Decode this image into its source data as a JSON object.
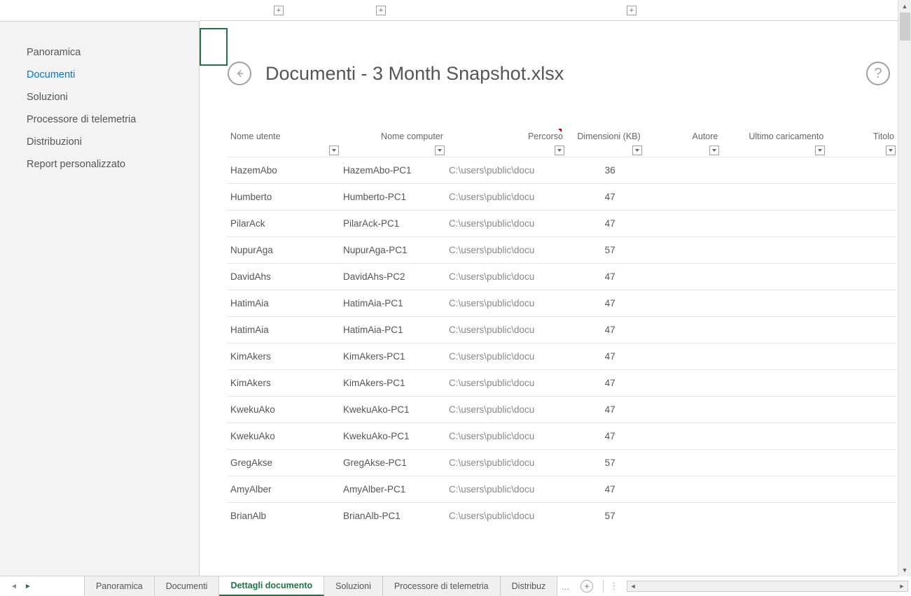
{
  "sidebar": {
    "items": [
      {
        "label": "Panoramica"
      },
      {
        "label": "Documenti"
      },
      {
        "label": "Soluzioni"
      },
      {
        "label": "Processore di telemetria"
      },
      {
        "label": "Distribuzioni"
      },
      {
        "label": "Report personalizzato"
      }
    ],
    "active_index": 1
  },
  "title": "Documenti - 3 Month Snapshot.xlsx",
  "columns": [
    {
      "label": "Nome utente",
      "align": "left"
    },
    {
      "label": "Nome computer",
      "align": "right"
    },
    {
      "label": "Percorso",
      "align": "right",
      "red": true
    },
    {
      "label": "Dimensioni (KB)",
      "align": "right"
    },
    {
      "label": "Autore",
      "align": "right"
    },
    {
      "label": "Ultimo caricamento",
      "align": "right"
    },
    {
      "label": "Titolo",
      "align": "right"
    }
  ],
  "rows": [
    {
      "user": "HazemAbo",
      "computer": "HazemAbo-PC1",
      "path": "C:\\users\\public\\docu",
      "size": "36"
    },
    {
      "user": "Humberto",
      "computer": "Humberto-PC1",
      "path": "C:\\users\\public\\docu",
      "size": "47"
    },
    {
      "user": "PilarAck",
      "computer": "PilarAck-PC1",
      "path": "C:\\users\\public\\docu",
      "size": "47"
    },
    {
      "user": "NupurAga",
      "computer": "NupurAga-PC1",
      "path": "C:\\users\\public\\docu",
      "size": "57"
    },
    {
      "user": "DavidAhs",
      "computer": "DavidAhs-PC2",
      "path": "C:\\users\\public\\docu",
      "size": "47"
    },
    {
      "user": "HatimAia",
      "computer": "HatimAia-PC1",
      "path": "C:\\users\\public\\docu",
      "size": "47"
    },
    {
      "user": "HatimAia",
      "computer": "HatimAia-PC1",
      "path": "C:\\users\\public\\docu",
      "size": "47"
    },
    {
      "user": "KimAkers",
      "computer": "KimAkers-PC1",
      "path": "C:\\users\\public\\docu",
      "size": "47"
    },
    {
      "user": "KimAkers",
      "computer": "KimAkers-PC1",
      "path": "C:\\users\\public\\docu",
      "size": "47"
    },
    {
      "user": "KwekuAko",
      "computer": "KwekuAko-PC1",
      "path": "C:\\users\\public\\docu",
      "size": "47"
    },
    {
      "user": "KwekuAko",
      "computer": "KwekuAko-PC1",
      "path": "C:\\users\\public\\docu",
      "size": "47"
    },
    {
      "user": "GregAkse",
      "computer": "GregAkse-PC1",
      "path": "C:\\users\\public\\docu",
      "size": "57"
    },
    {
      "user": "AmyAlber",
      "computer": "AmyAlber-PC1",
      "path": "C:\\users\\public\\docu",
      "size": "47"
    },
    {
      "user": "BrianAlb",
      "computer": "BrianAlb-PC1",
      "path": "C:\\users\\public\\docu",
      "size": "57"
    }
  ],
  "tabs": [
    {
      "label": "Panoramica"
    },
    {
      "label": "Documenti"
    },
    {
      "label": "Dettagli documento"
    },
    {
      "label": "Soluzioni"
    },
    {
      "label": "Processore di telemetria"
    },
    {
      "label": "Distribuz"
    }
  ],
  "tabs_active_index": 2,
  "tab_more": "...",
  "plus": "+"
}
